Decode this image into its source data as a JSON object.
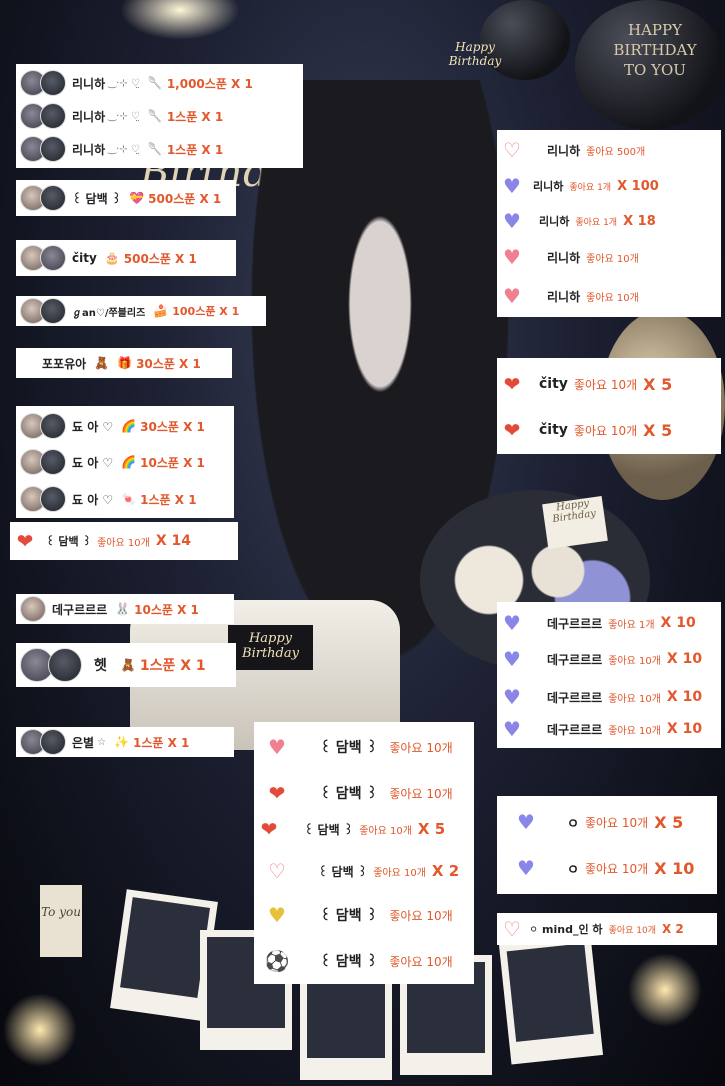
{
  "background": {
    "balloon_text": "HAPPY BIRTHDAY TO YOU",
    "hat_text": "Happy Birthday",
    "neon_text": "Birthday",
    "card_text": "Happy Birthday",
    "cake_plate_text": "Happy Birthday",
    "tag_text": "To you",
    "colors": {
      "accent": "#e2572b",
      "card_bg": "#ffffff",
      "bg_dark": "#0e1019"
    }
  },
  "spoon_cards": [
    {
      "rows": [
        {
          "name": "리니하",
          "deco": "‿·⊹ ♡̤",
          "gift": "1,000스푼 X 1"
        },
        {
          "name": "리니하",
          "deco": "‿·⊹ ♡̤",
          "gift": "1스푼 X 1"
        },
        {
          "name": "리니하",
          "deco": "‿·⊹ ♡̤",
          "gift": "1스푼 X 1"
        }
      ]
    },
    {
      "rows": [
        {
          "name": "꒰ 담백 ꒱",
          "deco": "",
          "gift": "500스푼 X 1"
        }
      ]
    },
    {
      "rows": [
        {
          "name": "čity",
          "deco": "",
          "gift": "500스푼 X 1"
        }
      ]
    },
    {
      "rows": [
        {
          "name": "ℊan♡/쭈블리즈",
          "deco": "",
          "gift": "100스푼 X 1"
        }
      ]
    },
    {
      "rows": [
        {
          "name": "포포유아",
          "deco": "",
          "gift": "30스푼 X 1"
        }
      ]
    },
    {
      "rows": [
        {
          "name": "됴 아 ♡",
          "deco": "",
          "gift": "30스푼 X 1"
        },
        {
          "name": "됴 아 ♡",
          "deco": "",
          "gift": "10스푼 X 1"
        },
        {
          "name": "됴 아 ♡",
          "deco": "",
          "gift": "1스푼 X 1"
        }
      ]
    },
    {
      "rows": [
        {
          "name": "데구르르르",
          "deco": "",
          "gift": "10스푼 X 1"
        }
      ]
    },
    {
      "rows": [
        {
          "name": "헷",
          "deco": "",
          "gift": "1스푼 X 1"
        }
      ]
    },
    {
      "rows": [
        {
          "name": "은별",
          "deco": "☆",
          "gift": "1스푼 X 1"
        }
      ]
    }
  ],
  "like_cards": [
    {
      "rows": [
        {
          "name": "꒰ 담백 ꒱",
          "likes": "좋아요 10개",
          "mult": "X 14"
        }
      ]
    },
    {
      "rows": [
        {
          "name": "리니하",
          "likes": "좋아요 500개",
          "mult": ""
        },
        {
          "name": "리니하",
          "likes": "좋아요 1개",
          "mult": "X 100"
        },
        {
          "name": "리니하",
          "likes": "좋아요 1개",
          "mult": "X 18"
        },
        {
          "name": "리니하",
          "likes": "좋아요 10개",
          "mult": ""
        },
        {
          "name": "리니하",
          "likes": "좋아요 10개",
          "mult": ""
        }
      ]
    },
    {
      "rows": [
        {
          "name": "čity",
          "likes": "좋아요 10개",
          "mult": "X 5"
        },
        {
          "name": "čity",
          "likes": "좋아요 10개",
          "mult": "X 5"
        }
      ]
    },
    {
      "rows": [
        {
          "name": "데구르르르",
          "likes": "좋아요 1개",
          "mult": "X 10"
        },
        {
          "name": "데구르르르",
          "likes": "좋아요 10개",
          "mult": "X 10"
        },
        {
          "name": "데구르르르",
          "likes": "좋아요 10개",
          "mult": "X 10"
        },
        {
          "name": "데구르르르",
          "likes": "좋아요 10개",
          "mult": "X 10"
        }
      ]
    },
    {
      "rows": [
        {
          "name": "꒰ 담백 ꒱",
          "likes": "좋아요 10개",
          "mult": ""
        },
        {
          "name": "꒰ 담백 ꒱",
          "likes": "좋아요 10개",
          "mult": ""
        },
        {
          "name": "꒰ 담백 ꒱",
          "likes": "좋아요 10개",
          "mult": "X 5"
        },
        {
          "name": "꒰ 담백 ꒱",
          "likes": "좋아요 10개",
          "mult": "X 2"
        },
        {
          "name": "꒰ 담백 ꒱",
          "likes": "좋아요 10개",
          "mult": ""
        },
        {
          "name": "꒰ 담백 ꒱",
          "likes": "좋아요 10개",
          "mult": ""
        }
      ]
    },
    {
      "rows": [
        {
          "name": "ㅇ",
          "likes": "좋아요 10개",
          "mult": "X 5"
        },
        {
          "name": "ㅇ",
          "likes": "좋아요 10개",
          "mult": "X 10"
        }
      ]
    },
    {
      "rows": [
        {
          "name": "⚪ mind_인 하",
          "likes": "좋아요 10개",
          "mult": "X 2"
        }
      ]
    }
  ]
}
